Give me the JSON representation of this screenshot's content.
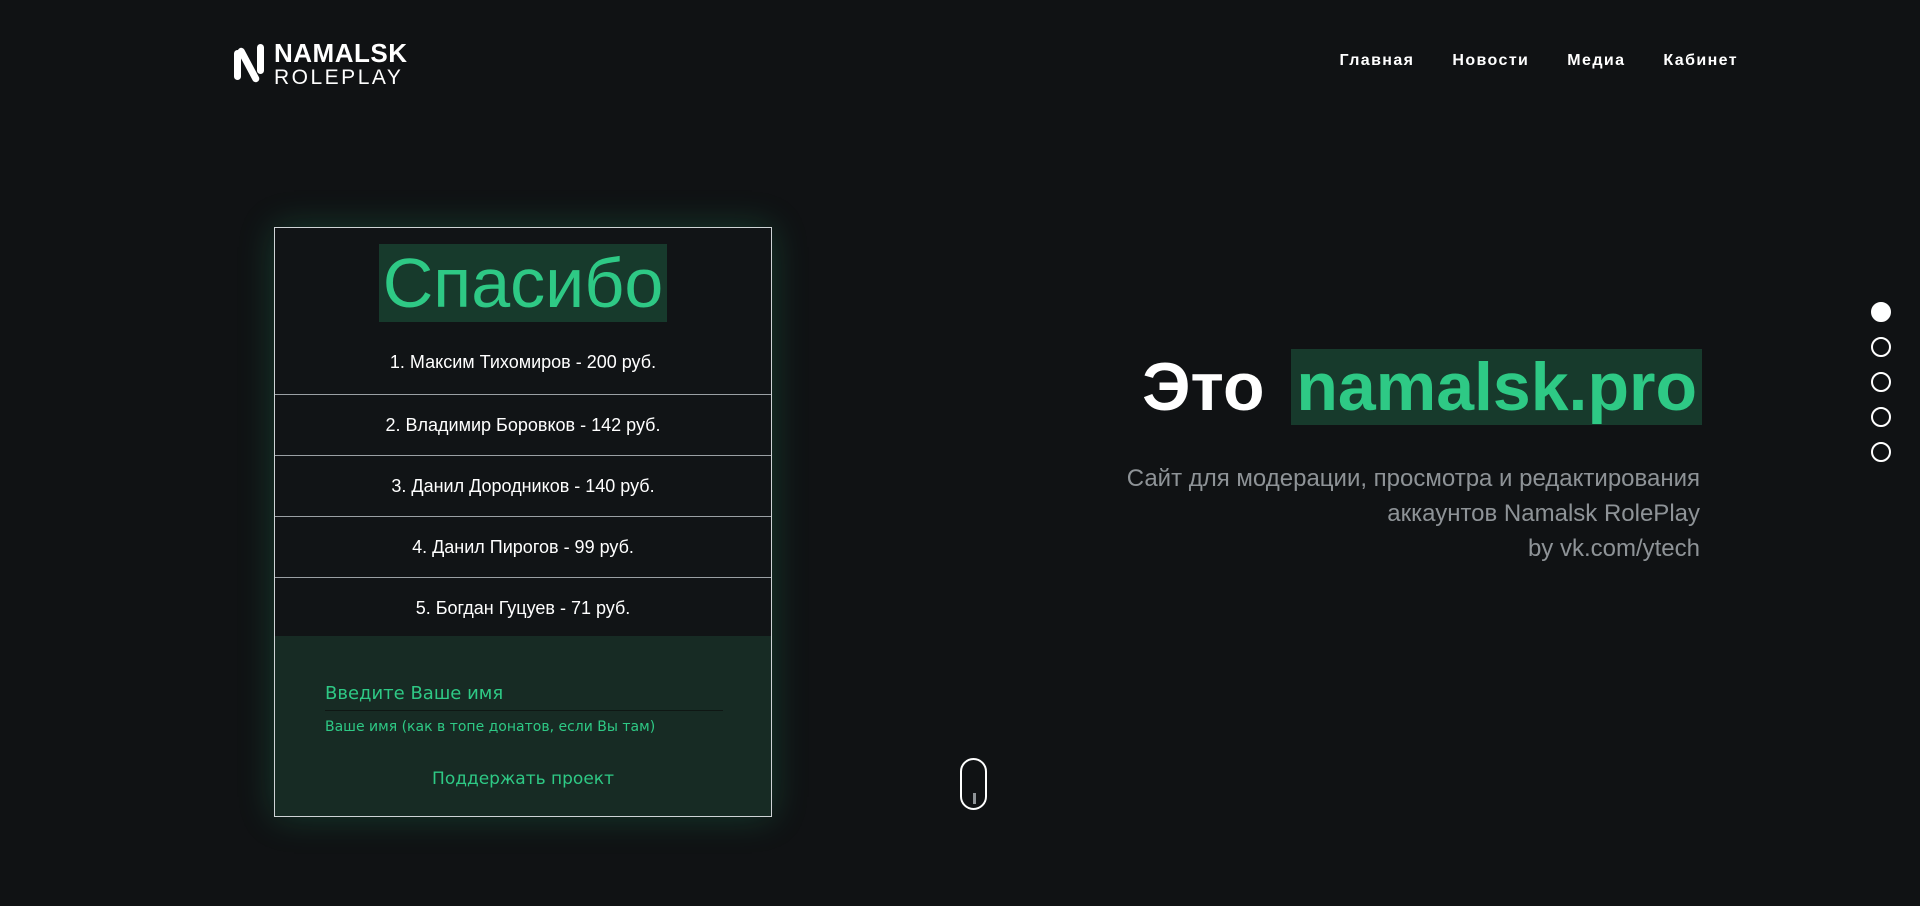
{
  "header": {
    "logo_top": "NAMALSK",
    "logo_bottom": "ROLEPLAY",
    "nav": [
      "Главная",
      "Новости",
      "Медиа",
      "Кабинет"
    ]
  },
  "donors": {
    "title": "Спасибо",
    "rows": [
      "1. Максим Тихомиров - 200 руб.",
      "2. Владимир Боровков - 142 руб.",
      "3. Данил Дородников - 140 руб.",
      "4. Данил Пирогов - 99 руб.",
      "5. Богдан Гуцуев - 71 руб."
    ],
    "form": {
      "name_placeholder": "Введите Ваше имя",
      "hint": "Ваше имя (как в топе донатов, если Вы там)",
      "button_label": "Поддержать проект"
    }
  },
  "hero": {
    "title_prefix": "Это",
    "title_highlight": "namalsk.pro",
    "subtitle_lines": [
      "Сайт для модерации, просмотра и редактирования",
      "аккаунтов Namalsk RolePlay",
      "by vk.com/ytech"
    ]
  },
  "colors": {
    "background": "#101214",
    "accent": "#2ec985",
    "accent_bg": "#173a2c",
    "muted_text": "#8e9397"
  },
  "section_dots": {
    "count": 5,
    "active_index": 0
  }
}
